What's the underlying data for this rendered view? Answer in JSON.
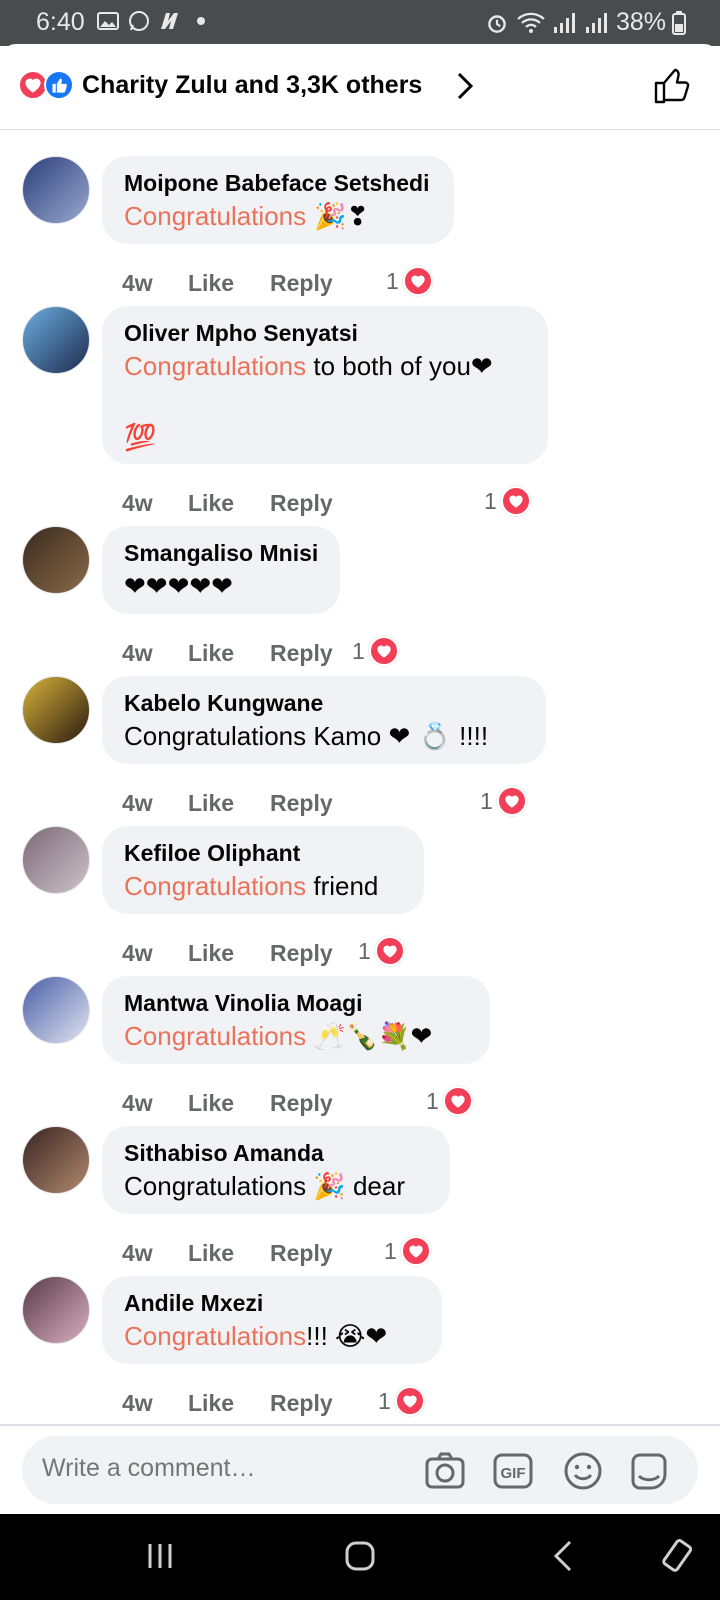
{
  "status_bar": {
    "time": "6:40",
    "battery": "38%"
  },
  "header": {
    "title": "Charity Zulu and 3,3K others"
  },
  "comments": [
    {
      "name": "Moipone Babeface Setshedi",
      "highlight": "Congratulations",
      "rest": "",
      "emoji": " 🎉❣",
      "time": "4w",
      "like": "Like",
      "reply": "Reply",
      "reactions": "1"
    },
    {
      "name": "Oliver Mpho Senyatsi",
      "highlight": "Congratulations",
      "rest": " to both of you",
      "emoji": "❤",
      "extra_line": "💯",
      "time": "4w",
      "like": "Like",
      "reply": "Reply",
      "reactions": "1"
    },
    {
      "name": "Smangaliso Mnisi",
      "highlight": "",
      "rest": "",
      "emoji": "❤❤❤❤❤",
      "time": "4w",
      "like": "Like",
      "reply": "Reply",
      "reactions": "1"
    },
    {
      "name": "Kabelo Kungwane",
      "highlight": "",
      "rest": "Congratulations Kamo ",
      "emoji": "❤ 💍 ",
      "tail": "!!!!",
      "time": "4w",
      "like": "Like",
      "reply": "Reply",
      "reactions": "1"
    },
    {
      "name": "Kefiloe Oliphant",
      "highlight": "Congratulations",
      "rest": " friend",
      "emoji": "",
      "time": "4w",
      "like": "Like",
      "reply": "Reply",
      "reactions": "1"
    },
    {
      "name": "Mantwa Vinolia Moagi",
      "highlight": "Congratulations",
      "rest": " ",
      "emoji": "🥂🍾💐❤",
      "time": "4w",
      "like": "Like",
      "reply": "Reply",
      "reactions": "1"
    },
    {
      "name": "Sithabiso Amanda",
      "highlight": "",
      "rest": "Congratulations ",
      "emoji": "🎉",
      "tail": " dear",
      "time": "4w",
      "like": "Like",
      "reply": "Reply",
      "reactions": "1"
    },
    {
      "name": "Andile Mxezi",
      "highlight": "Congratulations",
      "rest": "!!! ",
      "emoji": "😭❤",
      "time": "4w",
      "like": "Like",
      "reply": "Reply",
      "reactions": "1"
    }
  ],
  "composer": {
    "placeholder": "Write a comment…"
  },
  "colors": {
    "accent": "#1877f2",
    "love": "#f33e58",
    "highlight": "#e9735a",
    "bubble": "#f0f2f5"
  }
}
